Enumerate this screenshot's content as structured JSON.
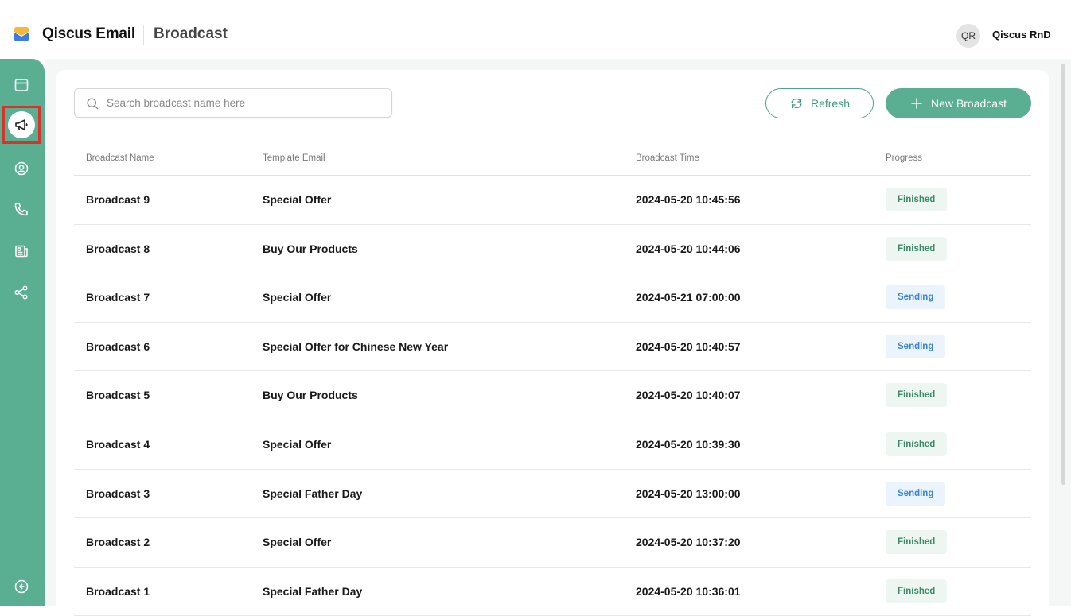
{
  "header": {
    "app_name": "Qiscus Email",
    "page_name": "Broadcast",
    "user_initials": "QR",
    "user_name": "Qiscus RnD"
  },
  "sidebar": {
    "items": [
      {
        "name": "inbox",
        "icon": "window-icon",
        "active": false
      },
      {
        "name": "broadcast",
        "icon": "megaphone-icon",
        "active": true
      },
      {
        "name": "contacts",
        "icon": "user-circle-icon",
        "active": false
      },
      {
        "name": "calls",
        "icon": "phone-icon",
        "active": false
      },
      {
        "name": "templates",
        "icon": "newspaper-icon",
        "active": false
      },
      {
        "name": "integrations",
        "icon": "share-nodes-icon",
        "active": false
      }
    ],
    "collapse_icon": "arrow-left-circle-icon"
  },
  "toolbar": {
    "search_placeholder": "Search broadcast name here",
    "refresh_label": "Refresh",
    "new_label": "New Broadcast"
  },
  "table": {
    "columns": [
      "Broadcast Name",
      "Template Email",
      "Broadcast Time",
      "Progress"
    ],
    "rows": [
      {
        "name": "Broadcast 9",
        "template": "Special Offer",
        "time": "2024-05-20 10:45:56",
        "progress": "Finished"
      },
      {
        "name": "Broadcast 8",
        "template": "Buy Our Products",
        "time": "2024-05-20 10:44:06",
        "progress": "Finished"
      },
      {
        "name": "Broadcast 7",
        "template": "Special Offer",
        "time": "2024-05-21 07:00:00",
        "progress": "Sending"
      },
      {
        "name": "Broadcast 6",
        "template": "Special Offer for Chinese New Year",
        "time": "2024-05-20 10:40:57",
        "progress": "Sending"
      },
      {
        "name": "Broadcast 5",
        "template": "Buy Our Products",
        "time": "2024-05-20 10:40:07",
        "progress": "Finished"
      },
      {
        "name": "Broadcast 4",
        "template": "Special Offer",
        "time": "2024-05-20 10:39:30",
        "progress": "Finished"
      },
      {
        "name": "Broadcast 3",
        "template": "Special Father Day",
        "time": "2024-05-20 13:00:00",
        "progress": "Sending"
      },
      {
        "name": "Broadcast 2",
        "template": "Special Offer",
        "time": "2024-05-20 10:37:20",
        "progress": "Finished"
      },
      {
        "name": "Broadcast 1",
        "template": "Special Father Day",
        "time": "2024-05-20 10:36:01",
        "progress": "Finished"
      }
    ]
  },
  "colors": {
    "brand_green": "#5aaf92",
    "finished_bg": "#eef6f1",
    "finished_text": "#3b8a67",
    "sending_bg": "#ebf4fc",
    "sending_text": "#3a85d3",
    "active_highlight": "#d9322b"
  }
}
